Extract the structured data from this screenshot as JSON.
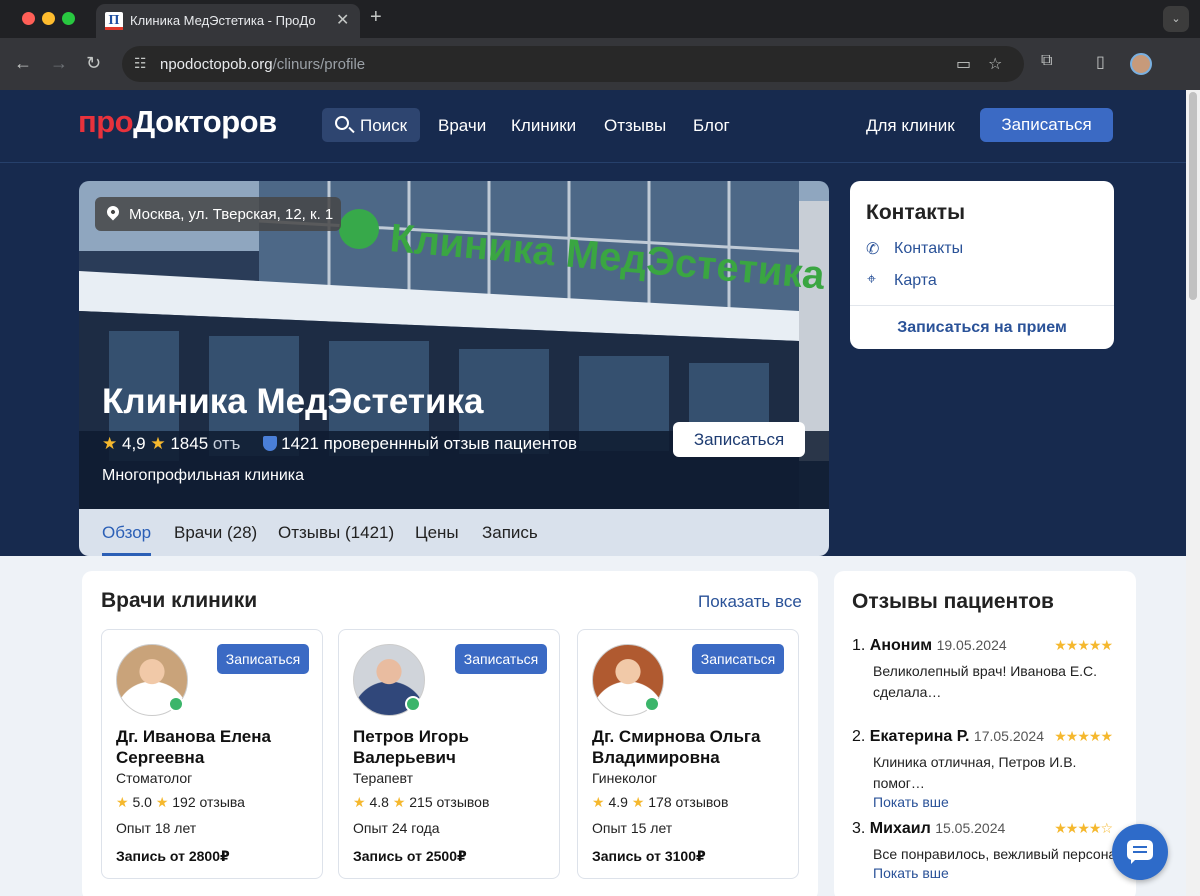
{
  "browser": {
    "tab_title": "Клиника МедЭстетика - ПроДо",
    "url_host": "npodoctopob.org",
    "url_path": "/clinurs/profile",
    "colors": {
      "close": "#ff5f57",
      "minimize": "#febc2e",
      "zoom": "#28c840"
    }
  },
  "header": {
    "logo_pro": "про",
    "logo_rest": "Докторов",
    "search": "Поиск",
    "nav": [
      "Врачи",
      "Клиники",
      "Отзывы",
      "Блог"
    ],
    "for_clinics": "Для клиник",
    "book": "Записаться"
  },
  "hero": {
    "sign": "Клиника МедЭстетика",
    "location": "Москва, ул. Тверская, 12, к. 1",
    "title": "Клиника МедЭстетика",
    "rating": "4,9",
    "reviews_count": "1845",
    "reviews_suffix": "отъ",
    "verified": "1421 провереннный отзыв пациентов",
    "type": "Многопрофильная клиника",
    "book": "Записаться"
  },
  "tabs": [
    "Обзор",
    "Врачи (28)",
    "Отзывы (1421)",
    "Цены",
    "Запись"
  ],
  "contacts": {
    "title": "Контакты",
    "phone": "Контакты",
    "map": "Карта",
    "book": "Записаться на прием"
  },
  "doctors": {
    "title": "Врачи клиники",
    "show_all": "Показать все",
    "items": [
      {
        "name": "Дг. Иванова Елена Сергеевна",
        "spec": "Стоматолог",
        "rating": "5.0",
        "reviews": "192 отзыва",
        "exp": "Опыт 18 лет",
        "price": "Запись от 2800₽",
        "book": "Записаться"
      },
      {
        "name": "Петров Игорь Валерьевич",
        "spec": "Терапевт",
        "rating": "4.8",
        "reviews": "215 отзывов",
        "exp": "Опыт 24 года",
        "price": "Запись от 2500₽",
        "book": "Записаться"
      },
      {
        "name": "Дг. Смирнова Ольга Владимировна",
        "spec": "Гинеколог",
        "rating": "4.9",
        "reviews": "178 отзывов",
        "exp": "Опыт 15 лет",
        "price": "Запись от 3100₽",
        "book": "Записаться"
      }
    ]
  },
  "reviews": {
    "title": "Отзывы пациентов",
    "items": [
      {
        "num": "1.",
        "author": "Аноним",
        "date": "19.05.2024",
        "stars": "★★★★★",
        "text": "Великолепный врач! Иванова Е.С. сделала…",
        "more": ""
      },
      {
        "num": "2.",
        "author": "Екатерина Р.",
        "date": "17.05.2024",
        "stars": "★★★★★",
        "text": "Клиника отличная, Петров И.В. помог…",
        "more": "Покать вше"
      },
      {
        "num": "3.",
        "author": "Михаил",
        "date": "15.05.2024",
        "stars": "★★★★☆",
        "text": "Все понравилось, вежливый персонал",
        "more": "Покать вше"
      }
    ]
  }
}
